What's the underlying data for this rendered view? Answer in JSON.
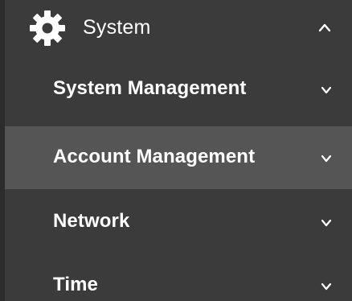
{
  "section": {
    "title": "System",
    "icon": "gear-icon",
    "expanded": true,
    "chevron_icon": "chevron-up-icon"
  },
  "items": [
    {
      "label": "System Management",
      "chevron_icon": "chevron-down-icon",
      "active": false
    },
    {
      "label": "Account Management",
      "chevron_icon": "chevron-down-icon",
      "active": true
    },
    {
      "label": "Network",
      "chevron_icon": "chevron-down-icon",
      "active": false
    },
    {
      "label": "Time",
      "chevron_icon": "chevron-down-icon",
      "active": false
    }
  ],
  "colors": {
    "background": "#3b3b3b",
    "active_background": "#555555",
    "text": "#ffffff"
  }
}
